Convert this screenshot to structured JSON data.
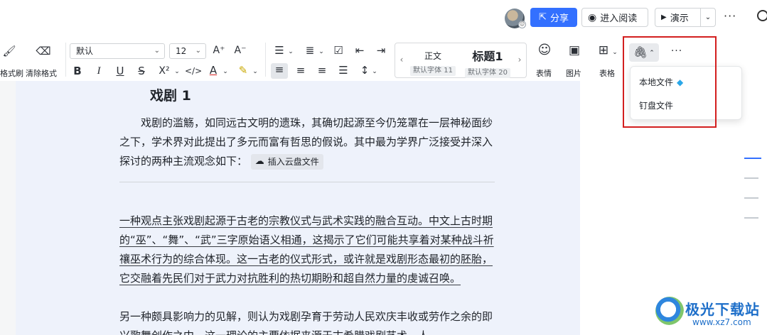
{
  "header": {
    "share_label": "分享",
    "reading_label": "进入阅读",
    "present_label": "演示",
    "more_icon": "···"
  },
  "toolbar": {
    "format_painter_label": "格式刷",
    "clear_format_label": "清除格式",
    "font_family": "默认",
    "font_size": "12",
    "bold": "B",
    "italic": "I",
    "underline": "U",
    "strike": "S",
    "superscript": "X²",
    "code": "</>",
    "font_color": "A",
    "styles": [
      {
        "name": "正文",
        "sub": "默认字体 11"
      },
      {
        "name": "标题1",
        "sub": "默认字体 20"
      }
    ],
    "emoji_label": "表情",
    "image_label": "图片",
    "table_label": "表格",
    "more_icon": "···"
  },
  "attachment_menu": {
    "items": [
      {
        "label": "本地文件"
      },
      {
        "label": "钉盘文件"
      }
    ]
  },
  "document": {
    "heading": "戏剧 1",
    "p1": "戏剧的滥觞，如同远古文明的遗珠，其确切起源至今仍笼罩在一层神秘面纱之下，学术界对此提出了多元而富有哲思的假说。其中最为学界广泛接受并深入探讨的两种主流观念如下：",
    "cloud_chip": "插入云盘文件",
    "p2": "一种观点主张戏剧起源于古老的宗教仪式与武术实践的融合互动。中文上古时期的“巫”、“舞”、“武”三字原始语义相通，这揭示了它们可能共享着对某种战斗祈禳巫术行为的综合体现。这一古老的仪式形式，或许就是戏剧形态最初的胚胎，它交融着先民们对于武力对抗胜利的热切期盼和超自然力量的虔诚召唤。",
    "p3": "另一种颇具影响力的见解，则认为戏剧孕育于劳动人民欢庆丰收或劳作之余的即兴歌舞创作之中。这一理论的主要依据来源于古希腊戏剧艺术，人"
  },
  "watermark": {
    "title": "极光下载站",
    "url": "www.xz7.com"
  },
  "colors": {
    "accent": "#3370ff",
    "highlight": "#d31f1f",
    "page_bg": "#eef2fb"
  }
}
